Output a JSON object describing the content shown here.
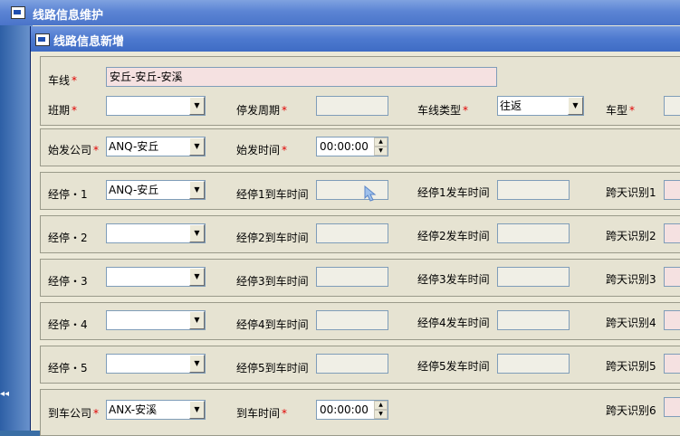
{
  "outer_window": {
    "title": "线路信息维护"
  },
  "dialog": {
    "title": "线路信息新增"
  },
  "form": {
    "route_label": "车线",
    "route_value": "安丘-安丘-安溪",
    "schedule_label": "班期",
    "period_label": "停发周期",
    "route_type_label": "车线类型",
    "route_type_value": "往返",
    "vehicle_type_label": "车型",
    "start_company_label": "始发公司",
    "start_company_value": "ANQ-安丘",
    "start_time_label": "始发时间",
    "start_time_value": "00:00:00",
    "stops": [
      {
        "label": "经停・1",
        "value": "ANQ-安丘",
        "arrive": "经停1到车时间",
        "depart": "经停1发车时间",
        "cross": "跨天识别1"
      },
      {
        "label": "经停・2",
        "value": "",
        "arrive": "经停2到车时间",
        "depart": "经停2发车时间",
        "cross": "跨天识别2"
      },
      {
        "label": "经停・3",
        "value": "",
        "arrive": "经停3到车时间",
        "depart": "经停3发车时间",
        "cross": "跨天识别3"
      },
      {
        "label": "经停・4",
        "value": "",
        "arrive": "经停4到车时间",
        "depart": "经停4发车时间",
        "cross": "跨天识别4"
      },
      {
        "label": "经停・5",
        "value": "",
        "arrive": "经停5到车时间",
        "depart": "经停5发车时间",
        "cross": "跨天识别5"
      }
    ],
    "end_company_label": "到车公司",
    "end_company_value": "ANX-安溪",
    "end_time_label": "到车时间",
    "end_time_value": "00:00:00",
    "cross6_label": "跨天识别6",
    "required_mark": "*"
  },
  "colors": {
    "required": "#e00000",
    "pink_field": "#f5e1e1"
  }
}
